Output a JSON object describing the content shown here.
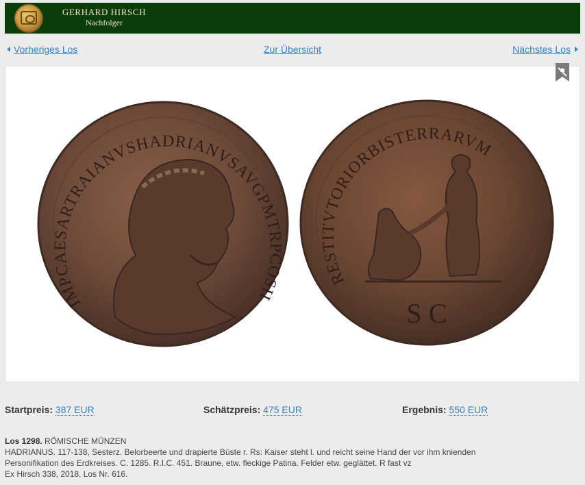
{
  "header": {
    "brand_name": "GERHARD HIRSCH",
    "brand_sub": "Nachfolger",
    "logo_icon": "seal-logo-icon"
  },
  "nav": {
    "prev_label": "Vorheriges Los",
    "overview_label": "Zur Übersicht",
    "next_label": "Nächstes Los"
  },
  "coin": {
    "obverse_legend": "IMPCAESARTRAIANVSHADRIANVSAVGPMTRPCOSIII",
    "reverse_legend": "RESTITVTORIORBISTERRARVM",
    "reverse_mark": "SC",
    "bookmark_icon": "bookmark-mute-icon"
  },
  "prices": {
    "start_label": "Startpreis:",
    "start_value": "387 EUR",
    "estimate_label": "Schätzpreis:",
    "estimate_value": "475 EUR",
    "result_label": "Ergebnis:",
    "result_value": "550 EUR"
  },
  "lot": {
    "number_label": "Los 1298.",
    "category": "RÖMISCHE MÜNZEN",
    "line1": "HADRIANUS. 117-138, Sesterz. Belorbeerte und drapierte Büste r. Rs: Kaiser steht l. und reicht seine Hand der vor ihm knienden",
    "line2": "Personifikation des Erdkreises. C. 1285. R.I.C. 451. Braune, etw. fleckige Patina. Felder etw. geglättet. R fast vz",
    "line3": "Ex Hirsch 338, 2018, Los Nr. 616."
  },
  "colors": {
    "header_bg": "#0b3d0b",
    "link": "#3a7fc1",
    "coin_bronze": "#6e4a3a"
  }
}
